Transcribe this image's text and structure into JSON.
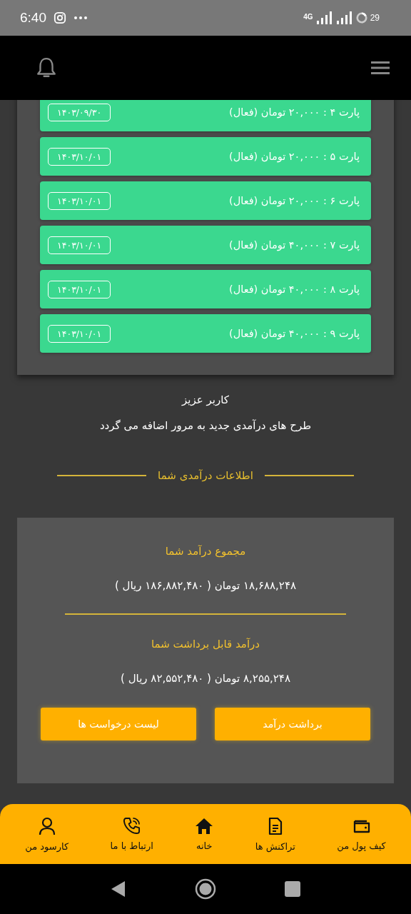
{
  "status_bar": {
    "time": "6:40",
    "network": "4G",
    "battery": "29"
  },
  "parts": [
    {
      "label": "پارت ۴ : ۲۰,۰۰۰ تومان (فعال)",
      "date": "۱۴۰۳/۰۹/۳۰"
    },
    {
      "label": "پارت ۵ : ۲۰,۰۰۰ تومان (فعال)",
      "date": "۱۴۰۳/۱۰/۰۱"
    },
    {
      "label": "پارت ۶ : ۲۰,۰۰۰ تومان (فعال)",
      "date": "۱۴۰۳/۱۰/۰۱"
    },
    {
      "label": "پارت ۷ : ۴۰,۰۰۰ تومان (فعال)",
      "date": "۱۴۰۳/۱۰/۰۱"
    },
    {
      "label": "پارت ۸ : ۴۰,۰۰۰ تومان (فعال)",
      "date": "۱۴۰۳/۱۰/۰۱"
    },
    {
      "label": "پارت ۹ : ۴۰,۰۰۰ تومان (فعال)",
      "date": "۱۴۰۳/۱۰/۰۱"
    }
  ],
  "notice": {
    "title": "کاربر عزیز",
    "text": "طرح های درآمدی جدید به مرور اضافه می گردد"
  },
  "section_heading": "اطلاعات درآمدی شما",
  "income": [
    {
      "title": "مجموع درآمد شما",
      "amount": "۱۸,۶۸۸,۲۴۸ تومان ( ۱۸۶,۸۸۲,۴۸۰ ریال )"
    },
    {
      "title": "درآمد قابل برداشت شما",
      "amount": "۸,۲۵۵,۲۴۸ تومان ( ۸۲,۵۵۲,۴۸۰ ریال )"
    }
  ],
  "buttons": [
    "برداشت درآمد",
    "لیست درخواست ها"
  ],
  "bottom_nav": [
    {
      "label": "کیف پول من"
    },
    {
      "label": "تراکنش ها"
    },
    {
      "label": "خانه"
    },
    {
      "label": "ارتباط با ما"
    },
    {
      "label": "کارسود من"
    }
  ]
}
